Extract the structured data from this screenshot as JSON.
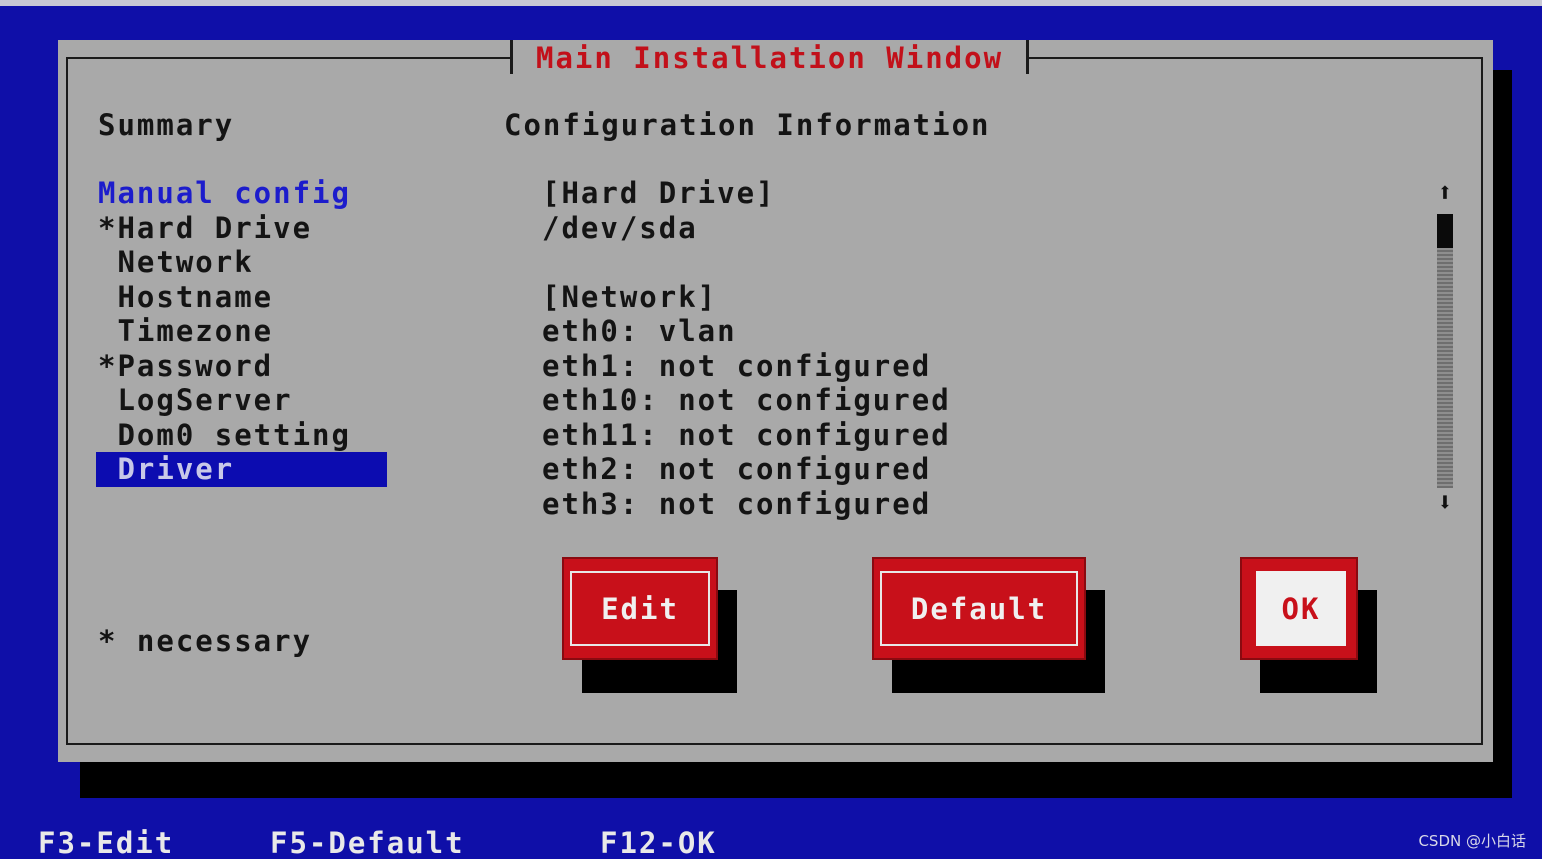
{
  "window": {
    "title": "Main Installation Window"
  },
  "summary": {
    "heading": "Summary",
    "items": [
      {
        "label": "Manual config",
        "kind": "group"
      },
      {
        "label": "*Hard Drive",
        "kind": "item"
      },
      {
        "label": " Network",
        "kind": "item"
      },
      {
        "label": " Hostname",
        "kind": "item"
      },
      {
        "label": " Timezone",
        "kind": "item"
      },
      {
        "label": "*Password",
        "kind": "item"
      },
      {
        "label": " LogServer",
        "kind": "item"
      },
      {
        "label": " Dom0 setting",
        "kind": "item"
      },
      {
        "label": " Driver",
        "kind": "selected"
      }
    ],
    "note": "* necessary"
  },
  "config": {
    "heading": "Configuration Information",
    "lines": [
      "[Hard Drive]",
      "/dev/sda",
      "",
      "[Network]",
      "eth0: vlan",
      "eth1: not configured",
      "eth10: not configured",
      "eth11: not configured",
      "eth2: not configured",
      "eth3: not configured"
    ]
  },
  "scrollbar": {
    "up_icon": "arrow-up-icon",
    "down_icon": "arrow-down-icon",
    "up_glyph": "⬆",
    "down_glyph": "⬇"
  },
  "buttons": {
    "edit": "Edit",
    "default": "Default",
    "ok": "OK"
  },
  "function_keys": {
    "f3": "F3-Edit",
    "f5": "F5-Default",
    "f12": "F12-OK"
  },
  "watermark": "CSDN @小白话",
  "colors": {
    "background": "#0f0fa8",
    "window": "#a9a9a9",
    "accent_red": "#c8101a",
    "selection": "#0c0cb0",
    "group_text": "#1c1ccc"
  }
}
